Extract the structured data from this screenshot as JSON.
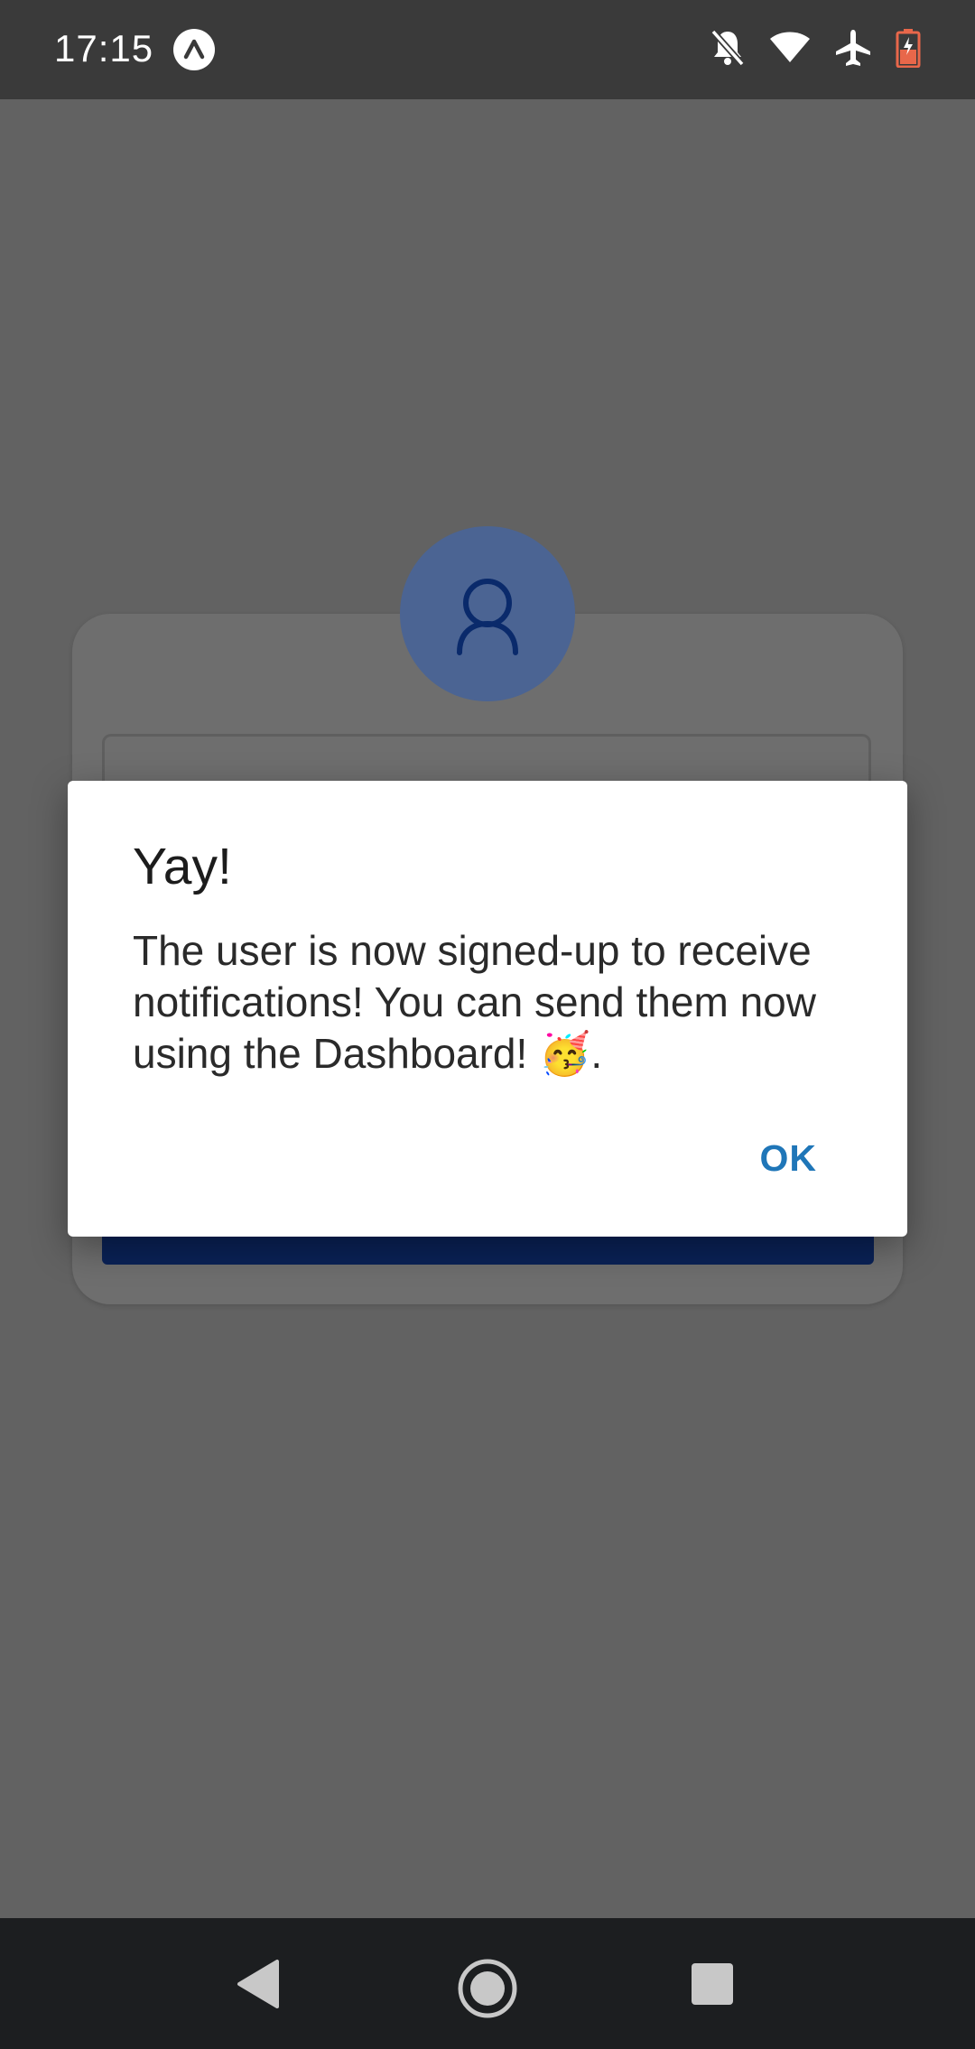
{
  "status_bar": {
    "time": "17:15",
    "app_icon": "notification-app-icon",
    "icons": [
      "bell-off-icon",
      "wifi-icon",
      "airplane-mode-icon",
      "battery-low-icon"
    ]
  },
  "dialog": {
    "title": "Yay!",
    "message": "The user is now signed-up to receive notifications! You can send them now using the Dashboard! 🥳.",
    "ok_label": "OK"
  },
  "nav_bar": {
    "icons": [
      "back-icon",
      "home-icon",
      "recents-icon"
    ]
  },
  "colors": {
    "scrim": "#626262",
    "status_bar": "#3a3a3a",
    "accent": "#1f76b8",
    "avatar_bg": "#4b6493",
    "primary_button": "#0a2257",
    "nav_bar": "#1c1e20"
  }
}
